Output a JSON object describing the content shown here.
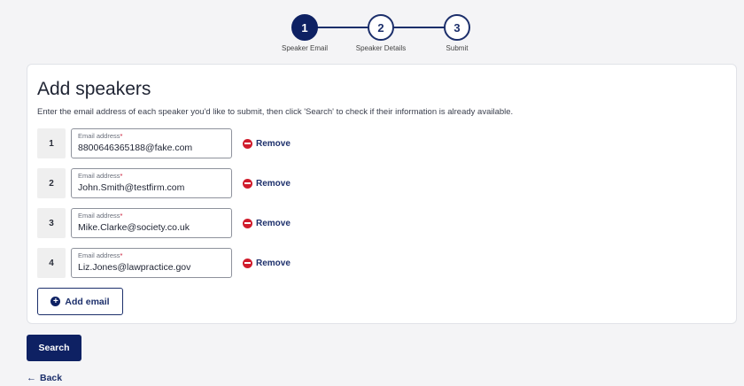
{
  "stepper": {
    "steps": [
      {
        "number": "1",
        "label": "Speaker Email"
      },
      {
        "number": "2",
        "label": "Speaker Details"
      },
      {
        "number": "3",
        "label": "Submit"
      }
    ]
  },
  "form": {
    "title": "Add speakers",
    "description": "Enter the email address of each speaker you'd like to submit, then click 'Search' to check if their information is already available.",
    "email_label": "Email address",
    "required_mark": "*",
    "remove_label": "Remove",
    "rows": [
      {
        "number": "1",
        "email": "8800646365188@fake.com"
      },
      {
        "number": "2",
        "email": "John.Smith@testfirm.com"
      },
      {
        "number": "3",
        "email": "Mike.Clarke@society.co.uk"
      },
      {
        "number": "4",
        "email": "Liz.Jones@lawpractice.gov"
      }
    ],
    "add_email_label": "Add email"
  },
  "actions": {
    "search_label": "Search",
    "back_label": "Back"
  },
  "colors": {
    "primary": "#0e2163",
    "remove": "#d01c2c"
  }
}
